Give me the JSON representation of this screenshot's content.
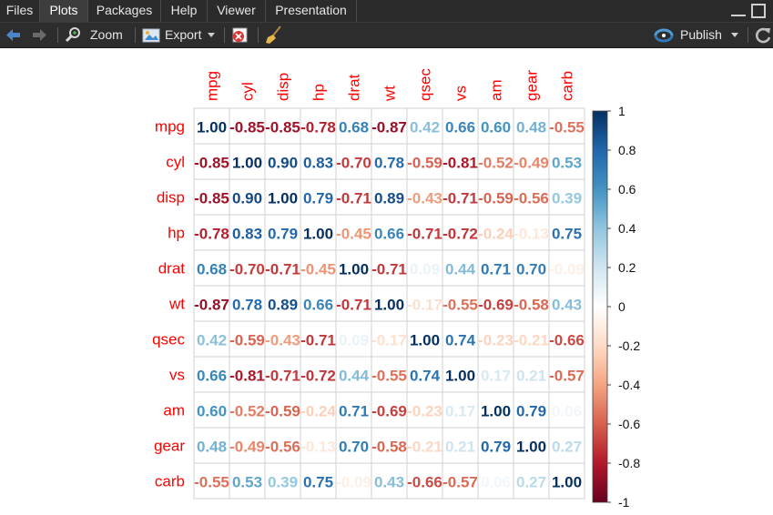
{
  "tabs": [
    {
      "label": "Files"
    },
    {
      "label": "Plots"
    },
    {
      "label": "Packages"
    },
    {
      "label": "Help"
    },
    {
      "label": "Viewer"
    },
    {
      "label": "Presentation"
    }
  ],
  "toolbar": {
    "zoom_label": "Zoom",
    "export_label": "Export",
    "publish_label": "Publish"
  },
  "colors": {
    "tab_bg": "#2b2b2b",
    "toolbar_bg": "#2d2d2d",
    "label_color": "#ff0000",
    "corr_high": "#053061",
    "corr_zero": "#ffffff",
    "corr_low": "#67001f"
  },
  "chart_data": {
    "type": "heatmap",
    "variables": [
      "mpg",
      "cyl",
      "disp",
      "hp",
      "drat",
      "wt",
      "qsec",
      "vs",
      "am",
      "gear",
      "carb"
    ],
    "values": [
      [
        "1.00",
        "-0.85",
        "-0.85",
        "-0.78",
        "0.68",
        "-0.87",
        "0.42",
        "0.66",
        "0.60",
        "0.48",
        "-0.55"
      ],
      [
        "-0.85",
        "1.00",
        "0.90",
        "0.83",
        "-0.70",
        "0.78",
        "-0.59",
        "-0.81",
        "-0.52",
        "-0.49",
        "0.53"
      ],
      [
        "-0.85",
        "0.90",
        "1.00",
        "0.79",
        "-0.71",
        "0.89",
        "-0.43",
        "-0.71",
        "-0.59",
        "-0.56",
        "0.39"
      ],
      [
        "-0.78",
        "0.83",
        "0.79",
        "1.00",
        "-0.45",
        "0.66",
        "-0.71",
        "-0.72",
        "-0.24",
        "-0.13",
        "0.75"
      ],
      [
        "0.68",
        "-0.70",
        "-0.71",
        "-0.45",
        "1.00",
        "-0.71",
        "0.09",
        "0.44",
        "0.71",
        "0.70",
        "-0.09"
      ],
      [
        "-0.87",
        "0.78",
        "0.89",
        "0.66",
        "-0.71",
        "1.00",
        "-0.17",
        "-0.55",
        "-0.69",
        "-0.58",
        "0.43"
      ],
      [
        "0.42",
        "-0.59",
        "-0.43",
        "-0.71",
        "0.09",
        "-0.17",
        "1.00",
        "0.74",
        "-0.23",
        "-0.21",
        "-0.66"
      ],
      [
        "0.66",
        "-0.81",
        "-0.71",
        "-0.72",
        "0.44",
        "-0.55",
        "0.74",
        "1.00",
        "0.17",
        "0.21",
        "-0.57"
      ],
      [
        "0.60",
        "-0.52",
        "-0.59",
        "-0.24",
        "0.71",
        "-0.69",
        "-0.23",
        "0.17",
        "1.00",
        "0.79",
        "0.06"
      ],
      [
        "0.48",
        "-0.49",
        "-0.56",
        "-0.13",
        "0.70",
        "-0.58",
        "-0.21",
        "0.21",
        "0.79",
        "1.00",
        "0.27"
      ],
      [
        "-0.55",
        "0.53",
        "0.39",
        "0.75",
        "-0.09",
        "0.43",
        "-0.66",
        "-0.57",
        "0.06",
        "0.27",
        "1.00"
      ]
    ],
    "colorbar_ticks": [
      "1",
      "0.8",
      "0.6",
      "0.4",
      "0.2",
      "0",
      "-0.2",
      "-0.4",
      "-0.6",
      "-0.8",
      "-1"
    ],
    "colorbar_range": [
      -1,
      1
    ],
    "grid": true
  }
}
